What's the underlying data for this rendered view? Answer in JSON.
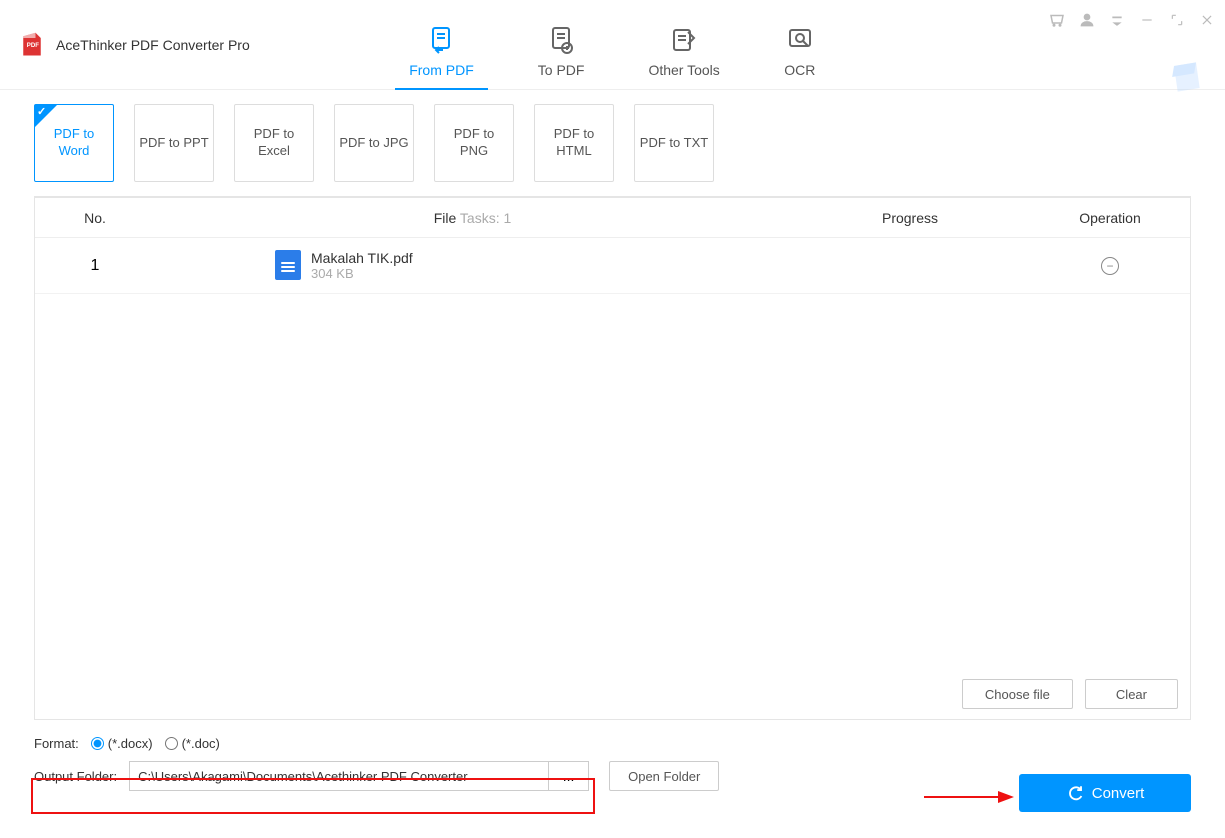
{
  "app": {
    "title": "AceThinker PDF Converter Pro"
  },
  "mainTabs": {
    "fromPdf": "From PDF",
    "toPdf": "To PDF",
    "otherTools": "Other Tools",
    "ocr": "OCR"
  },
  "types": {
    "pdfToWord": "PDF to Word",
    "pdfToPpt": "PDF to PPT",
    "pdfToExcel": "PDF to Excel",
    "pdfToJpg": "PDF to JPG",
    "pdfToPng": "PDF to PNG",
    "pdfToHtml": "PDF to HTML",
    "pdfToTxt": "PDF to TXT"
  },
  "table": {
    "headers": {
      "no": "No.",
      "file": "File",
      "tasksLabel": " Tasks: 1",
      "progress": "Progress",
      "operation": "Operation"
    },
    "rows": [
      {
        "no": "1",
        "name": "Makalah TIK.pdf",
        "size": "304 KB"
      }
    ],
    "chooseFile": "Choose file",
    "clear": "Clear"
  },
  "format": {
    "label": "Format:",
    "docx": "(*.docx)",
    "doc": "(*.doc)"
  },
  "output": {
    "label": "Output Folder:",
    "path": "C:\\Users\\Akagami\\Documents\\Acethinker PDF Converter",
    "browse": "...",
    "openFolder": "Open Folder"
  },
  "convert": "Convert"
}
